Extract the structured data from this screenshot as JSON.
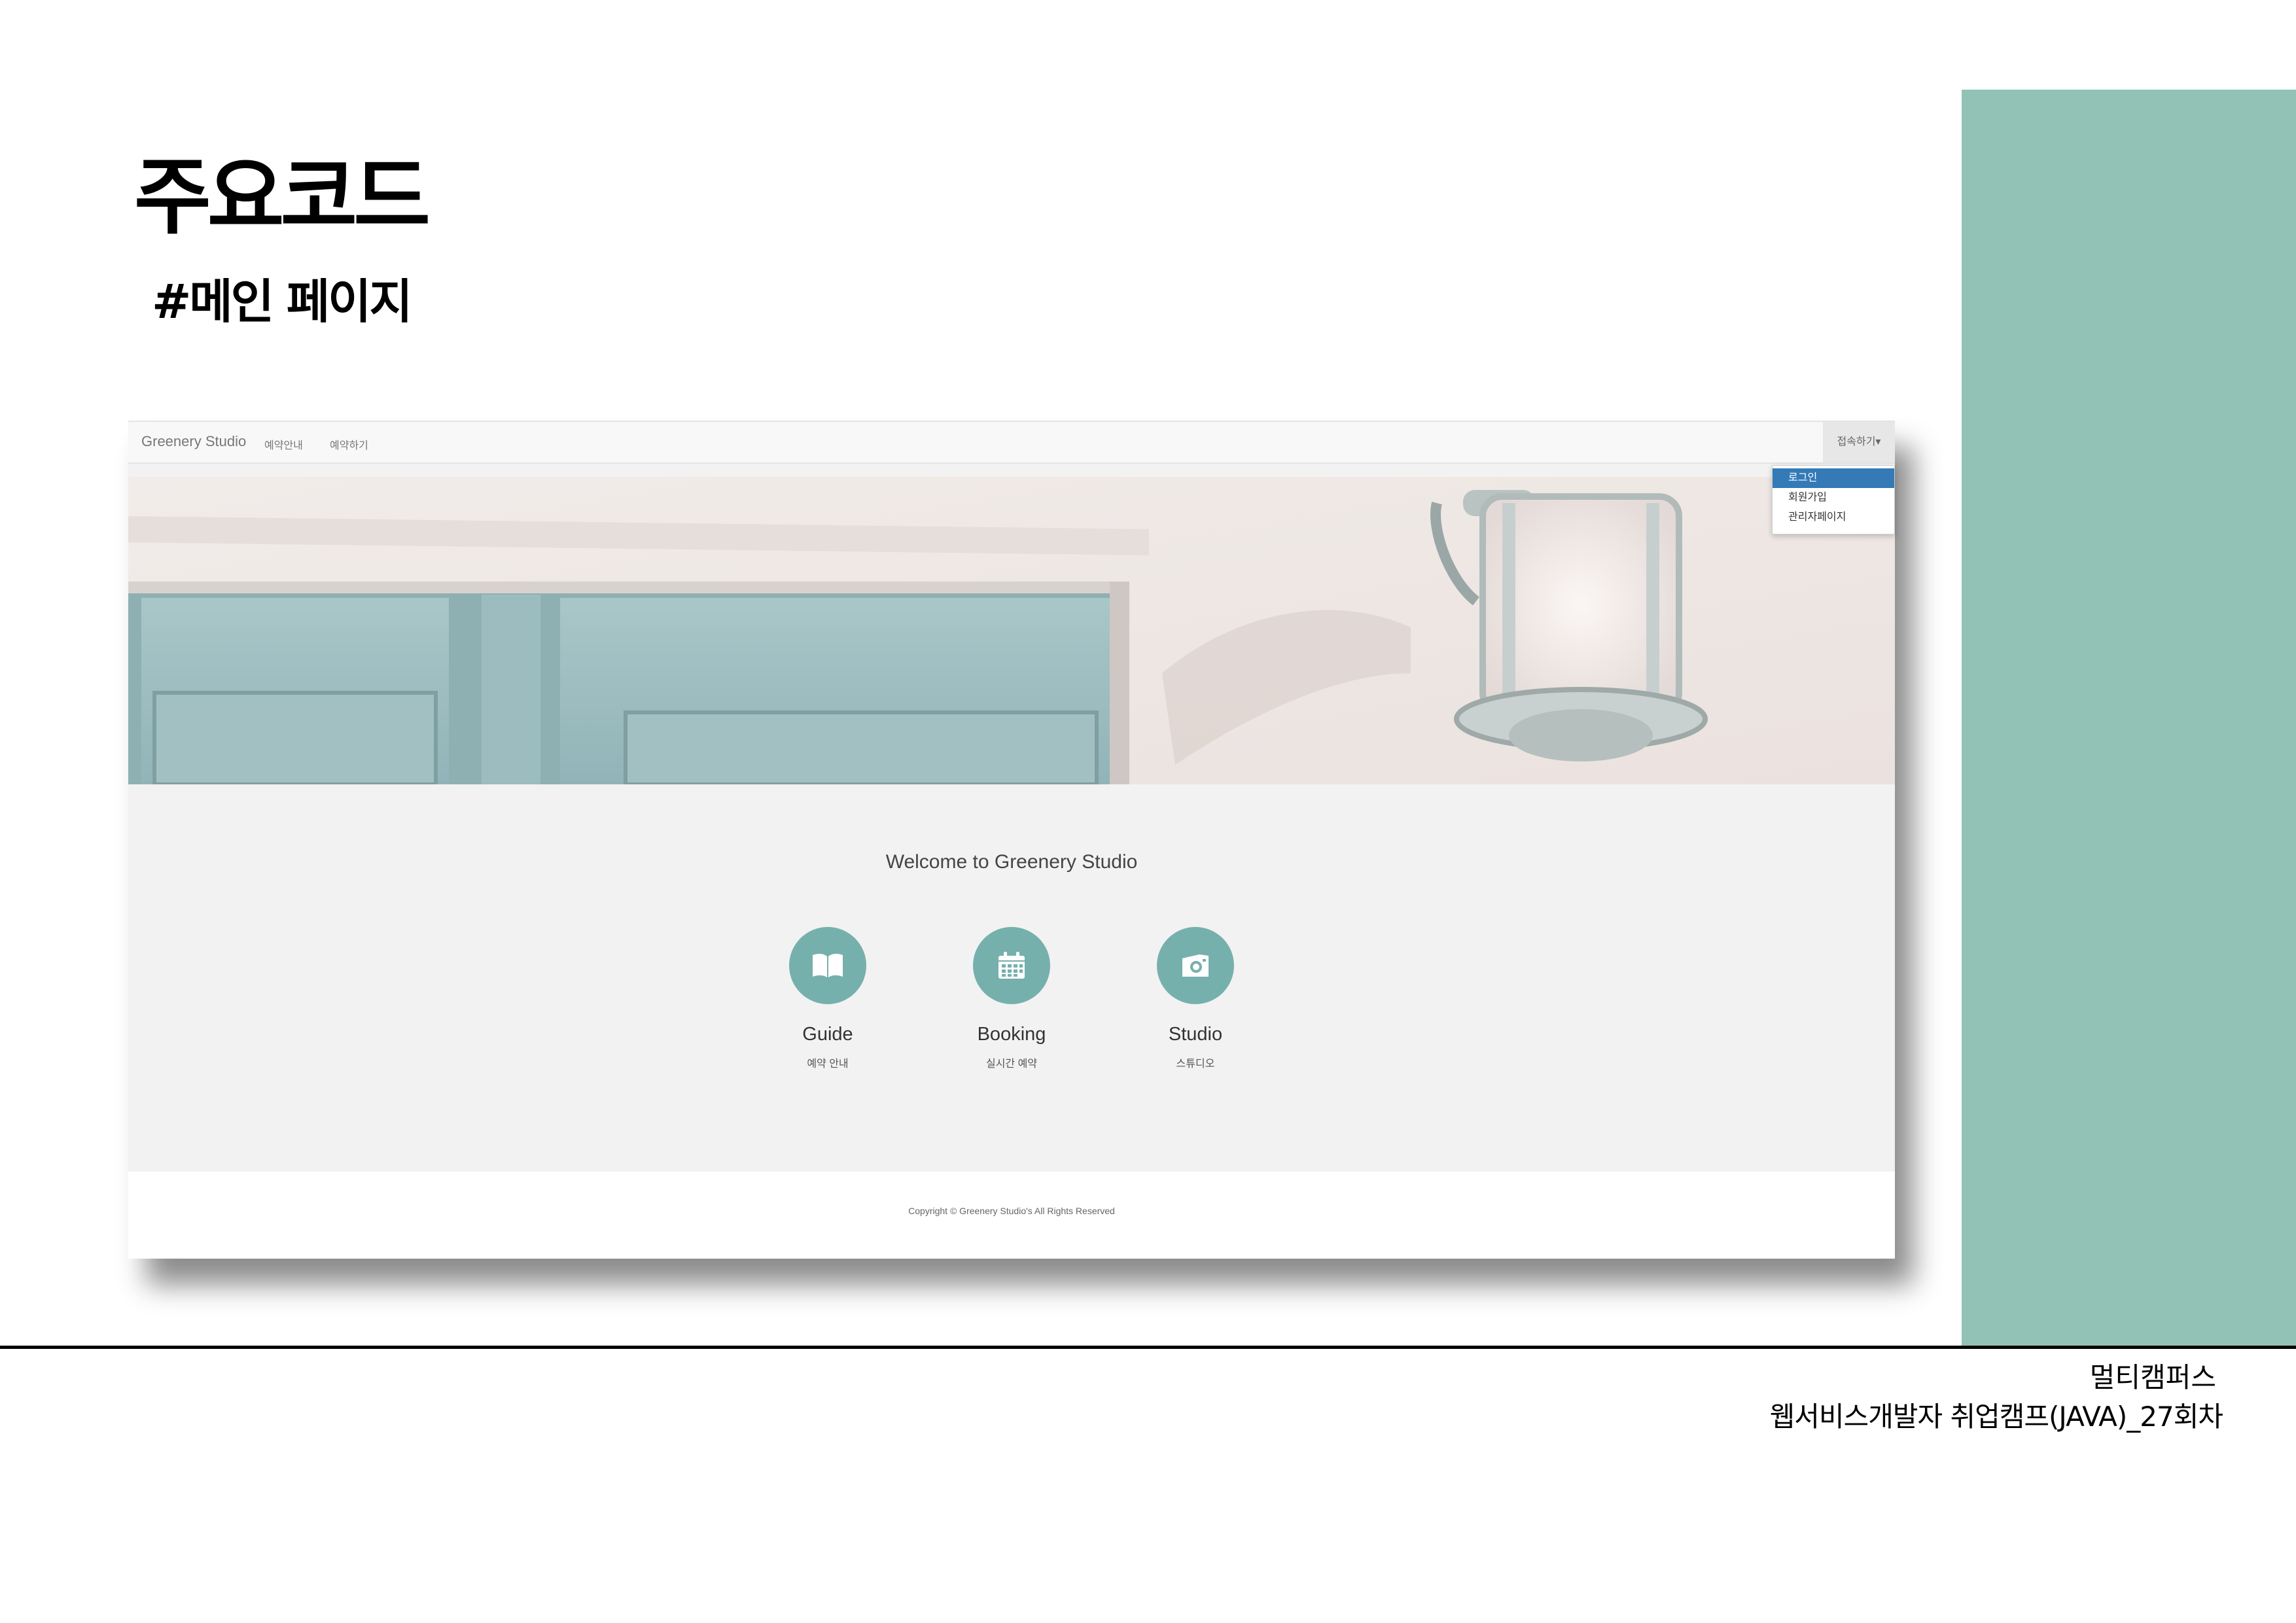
{
  "slide": {
    "title": "주요코드",
    "subtitle": "#메인 페이지",
    "footer_org": "멀티캠퍼스",
    "footer_course": "웹서비스개발자 취업캠프(JAVA)_27회차",
    "accent_color": "#92c2b6"
  },
  "site": {
    "navbar": {
      "brand": "Greenery Studio",
      "links": [
        "예약안내",
        "예약하기"
      ],
      "dropdown_label": "접속하기▾",
      "dropdown_items": [
        "로그인",
        "회원가입",
        "관리자페이지"
      ]
    },
    "welcome": "Welcome to Greenery Studio",
    "features": [
      {
        "title": "Guide",
        "subtitle": "예약 안내",
        "icon": "book-icon"
      },
      {
        "title": "Booking",
        "subtitle": "실시간 예약",
        "icon": "calendar-icon"
      },
      {
        "title": "Studio",
        "subtitle": "스튜디오",
        "icon": "camera-icon"
      }
    ],
    "copyright": "Copyright © Greenery Studio's All Rights Reserved",
    "feature_color": "#76b0ad",
    "active_item_color": "#337ab7"
  }
}
